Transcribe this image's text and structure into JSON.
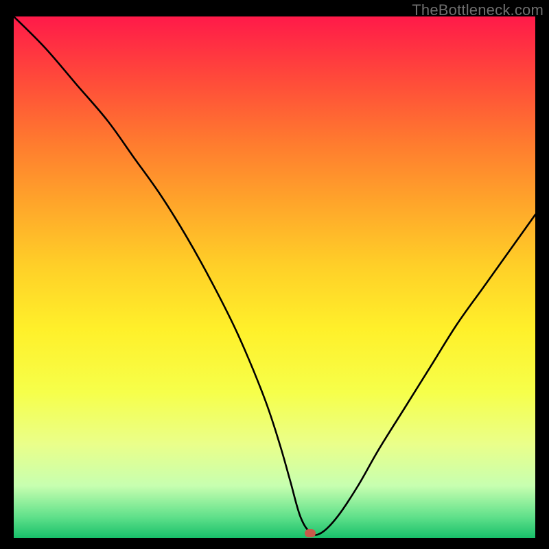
{
  "watermark": {
    "text": "TheBottleneck.com"
  },
  "marker": {
    "x_pct": 56.8,
    "y_pct": 99.1
  },
  "chart_data": {
    "type": "line",
    "title": "",
    "xlabel": "",
    "ylabel": "",
    "xlim": [
      0,
      100
    ],
    "ylim": [
      0,
      100
    ],
    "grid": false,
    "legend": false,
    "series": [
      {
        "name": "bottleneck-curve",
        "x": [
          0,
          6,
          12,
          18,
          23,
          28,
          33,
          38,
          43,
          48,
          51,
          53,
          55,
          57,
          59,
          62,
          66,
          70,
          75,
          80,
          85,
          90,
          95,
          100
        ],
        "y": [
          100,
          94,
          87,
          80,
          73,
          66,
          58,
          49,
          39,
          27,
          18,
          11,
          4,
          1,
          1,
          4,
          10,
          17,
          25,
          33,
          41,
          48,
          55,
          62
        ]
      }
    ],
    "annotations": [
      {
        "type": "marker",
        "x": 56.8,
        "y": 0.9,
        "color": "#c85a4a",
        "shape": "rounded-rect"
      }
    ],
    "background_gradient": {
      "top": "#ff1a49",
      "mid": "#ffd028",
      "bottom": "#18c06a"
    }
  }
}
